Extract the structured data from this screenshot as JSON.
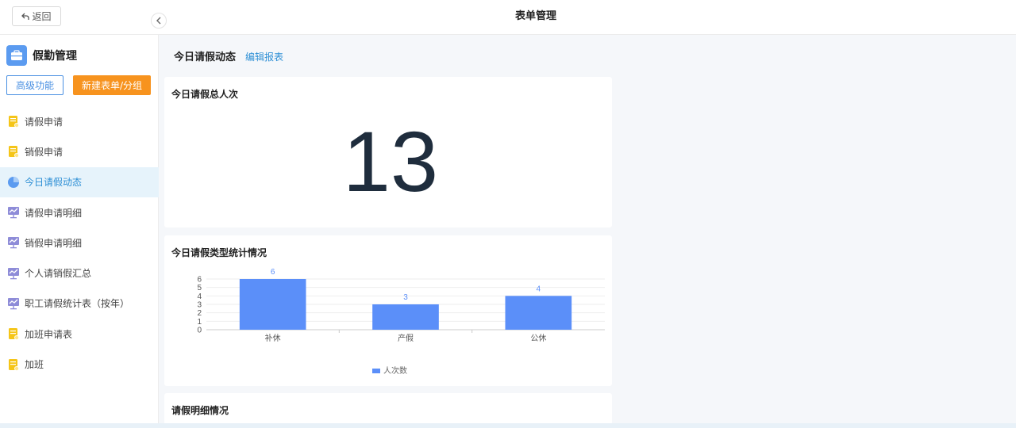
{
  "header": {
    "back_label": "返回",
    "title": "表单管理"
  },
  "sidebar": {
    "module_title": "假勤管理",
    "advanced_label": "高级功能",
    "new_label": "新建表单/分组",
    "items": [
      {
        "label": "请假申请",
        "icon": "form-icon"
      },
      {
        "label": "销假申请",
        "icon": "form-icon"
      },
      {
        "label": "今日请假动态",
        "icon": "pie-chart-icon",
        "active": true
      },
      {
        "label": "请假申请明细",
        "icon": "report-icon"
      },
      {
        "label": "销假申请明细",
        "icon": "report-icon"
      },
      {
        "label": "个人请销假汇总",
        "icon": "report-icon"
      },
      {
        "label": "职工请假统计表（按年）",
        "icon": "report-icon"
      },
      {
        "label": "加班申请表",
        "icon": "form-icon"
      },
      {
        "label": "加班",
        "icon": "form-icon"
      }
    ]
  },
  "main": {
    "title": "今日请假动态",
    "edit_label": "编辑报表",
    "total_card": {
      "title": "今日请假总人次",
      "value": "13"
    },
    "chart_card": {
      "title": "今日请假类型统计情况"
    },
    "detail_card": {
      "title": "请假明细情况"
    }
  },
  "chart_data": {
    "type": "bar",
    "categories": [
      "补休",
      "产假",
      "公休"
    ],
    "series": [
      {
        "name": "人次数",
        "values": [
          6,
          3,
          4
        ]
      }
    ],
    "ylim": [
      0,
      6
    ],
    "yticks": [
      0,
      1,
      2,
      3,
      4,
      5,
      6
    ],
    "legend": "bottom",
    "color": "#5b8ff9"
  },
  "colors": {
    "accent": "#2d8fd5",
    "primary_button": "#f7931e",
    "active_bg": "#e6f3fb"
  }
}
